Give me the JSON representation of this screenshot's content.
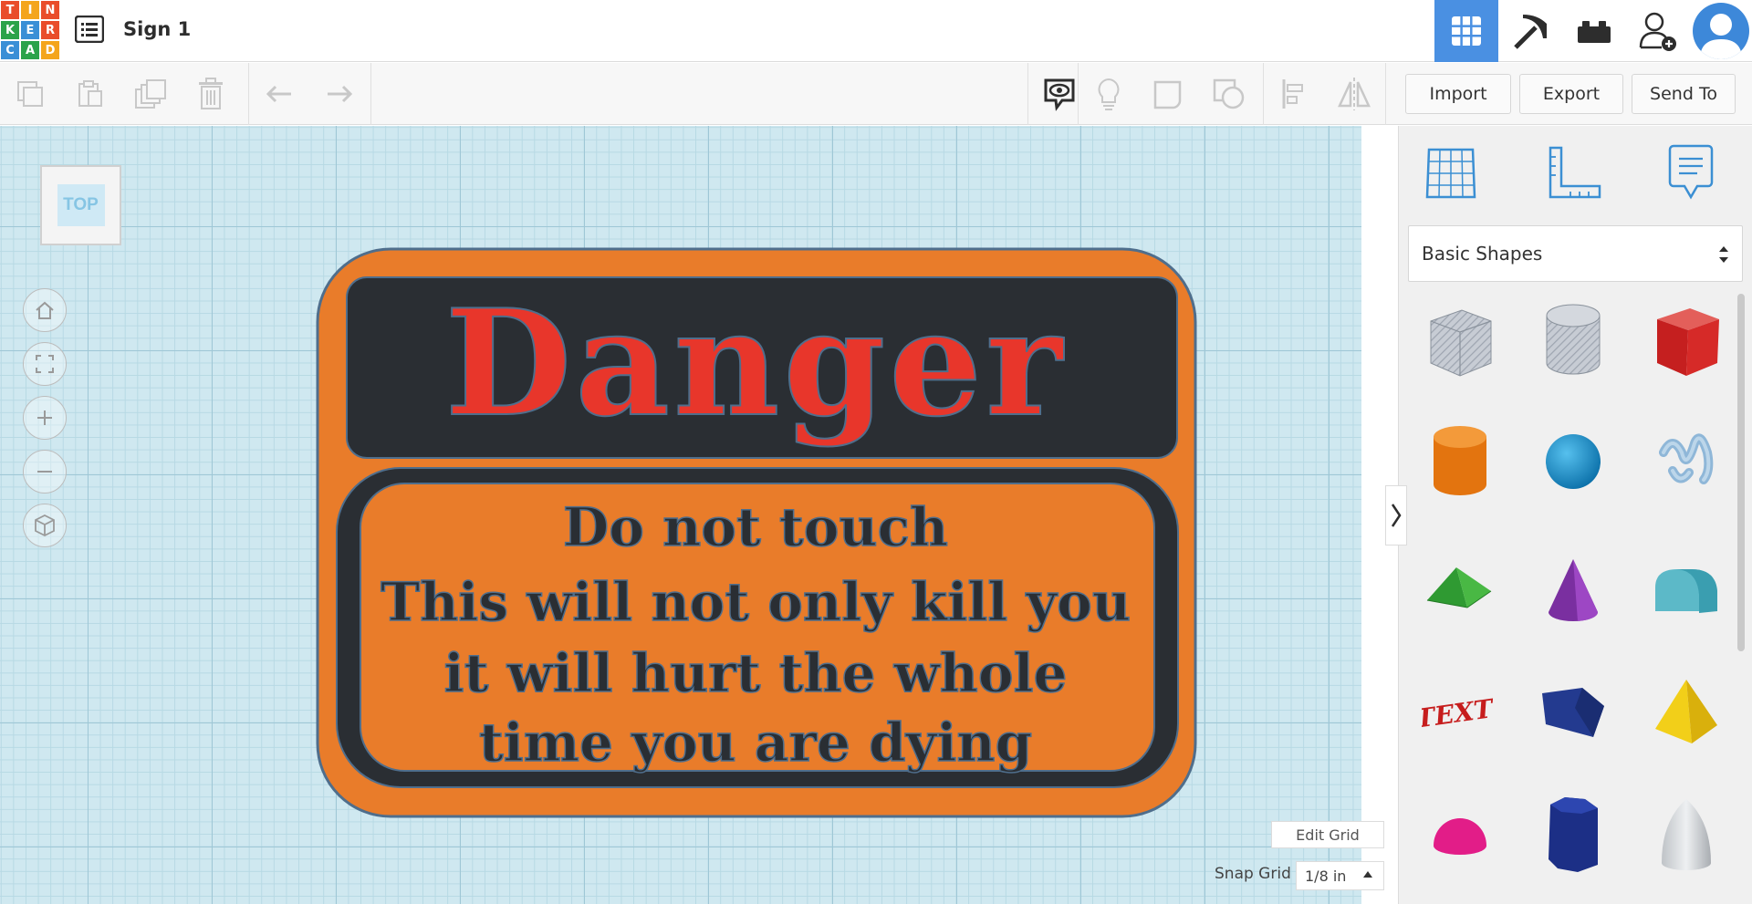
{
  "app": {
    "logo_letters": [
      "T",
      "I",
      "N",
      "K",
      "E",
      "R",
      "C",
      "A",
      "D"
    ],
    "logo_colors": [
      "#e94d2b",
      "#f4a51c",
      "#e94d2b",
      "#2ba34a",
      "#3a8fd6",
      "#e94d2b",
      "#3a8fd6",
      "#2ba34a",
      "#f4a51c"
    ],
    "design_title": "Sign 1"
  },
  "toolbar": {
    "import_label": "Import",
    "export_label": "Export",
    "send_to_label": "Send To"
  },
  "workplane": {
    "view_cube_label": "TOP",
    "edit_grid_label": "Edit Grid",
    "snap_grid_label": "Snap Grid",
    "snap_grid_value": "1/8 in"
  },
  "sign": {
    "heading": "Danger",
    "lines": [
      "Do not touch",
      "This will not only kill you",
      "it will hurt the whole",
      "time you are dying"
    ],
    "colors": {
      "orange": "#e97c2a",
      "dark": "#2a2e33",
      "red": "#e8362b",
      "outline": "#4f6e8c"
    }
  },
  "panel": {
    "library_selected": "Basic Shapes",
    "shapes": [
      "box-hole-icon",
      "cylinder-hole-icon",
      "box-icon",
      "cylinder-icon",
      "sphere-icon",
      "scribble-icon",
      "roof-icon",
      "cone-icon",
      "round-roof-icon",
      "text-icon",
      "wedge-icon",
      "pyramid-icon",
      "half-sphere-icon",
      "polygon-icon",
      "paraboloid-icon"
    ]
  },
  "colors": {
    "accent_blue": "#4a90e2",
    "workplane_bg": "#cfe8f0"
  }
}
